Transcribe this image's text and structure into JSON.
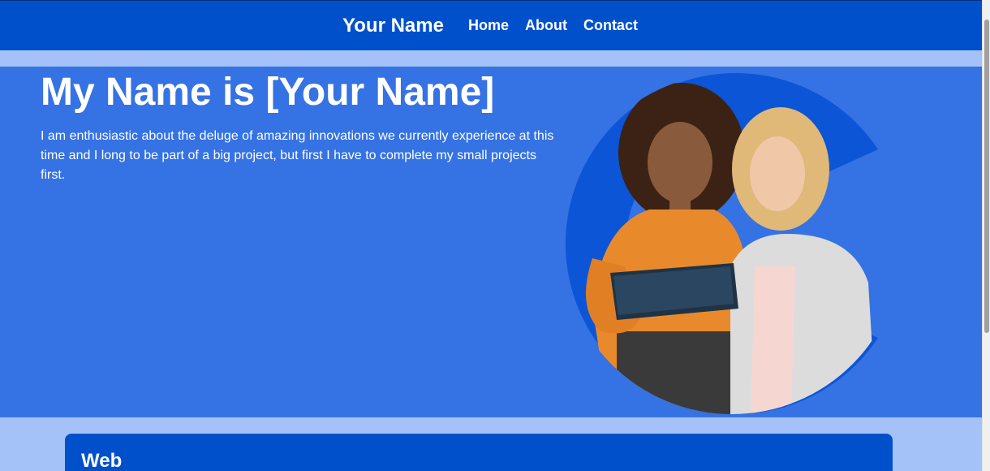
{
  "nav": {
    "brand": "Your Name",
    "links": [
      "Home",
      "About",
      "Contact"
    ]
  },
  "hero": {
    "title": "My Name is [Your Name]",
    "text": "I am enthusiastic about the deluge of amazing innovations we currently experience at this time and I long to be part of a big project, but first I have to complete my small projects first."
  },
  "card": {
    "title": "Web"
  },
  "colors": {
    "nav_bg": "#0050cc",
    "hero_bg": "#3572e3",
    "page_bg": "#a4c2f7"
  }
}
